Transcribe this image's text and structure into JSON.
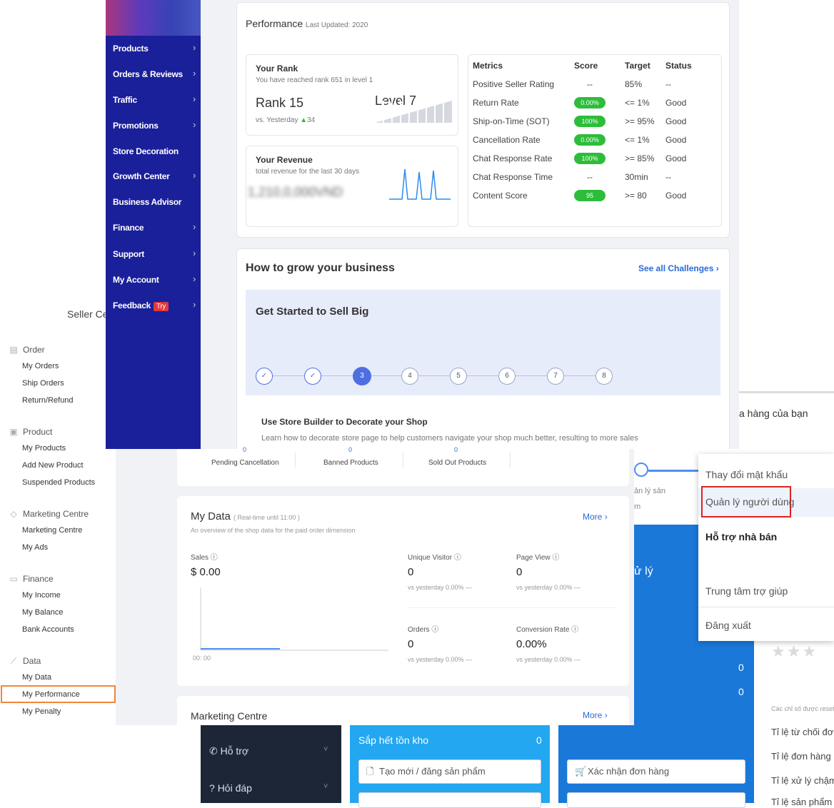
{
  "sidebar": {
    "seller_center_label": "Seller Ce",
    "sections": [
      {
        "title": "Order",
        "icon": "clipboard-icon",
        "items": [
          "My Orders",
          "Ship Orders",
          "Return/Refund"
        ]
      },
      {
        "title": "Product",
        "icon": "box-icon",
        "items": [
          "My Products",
          "Add New Product",
          "Suspended Products"
        ]
      },
      {
        "title": "Marketing Centre",
        "icon": "tag-icon",
        "items": [
          "Marketing Centre",
          "My Ads"
        ]
      },
      {
        "title": "Finance",
        "icon": "wallet-icon",
        "items": [
          "My Income",
          "My Balance",
          "Bank Accounts"
        ]
      },
      {
        "title": "Data",
        "icon": "chart-icon",
        "items": [
          "My Data",
          "My Performance",
          "My Penalty"
        ]
      }
    ],
    "highlight_color": "#f0873a"
  },
  "nav": {
    "items": [
      "Products",
      "Orders & Reviews",
      "Traffic",
      "Promotions",
      "Store Decoration",
      "Growth Center",
      "Business Advisor",
      "Finance",
      "Support",
      "My Account",
      "Feedback"
    ],
    "feedback_badge": "Try",
    "bg_color": "#1a1f9a"
  },
  "performance": {
    "title": "Performance",
    "last_updated": "Last Updated: 2020",
    "rank": {
      "heading": "Your Rank",
      "sub": "You have reached rank 651 in level 1",
      "rank_label": "Rank 15",
      "level_label": "Level 7",
      "vs_label": "vs. Yesterday",
      "delta": "34"
    },
    "revenue": {
      "heading": "Your Revenue",
      "sub": "total revenue for the last 30 days",
      "value_blurred": "1,210,0,000VND"
    },
    "metrics": {
      "headers": [
        "Metrics",
        "Score",
        "Target",
        "Status"
      ],
      "rows": [
        {
          "name": "Positive Seller Rating",
          "score": "--",
          "pill": false,
          "target": "85%",
          "status": "--"
        },
        {
          "name": "Return Rate",
          "score": "0.00%",
          "pill": true,
          "target": "<= 1%",
          "status": "Good"
        },
        {
          "name": "Ship-on-Time (SOT)",
          "score": "100%",
          "pill": true,
          "target": ">= 95%",
          "status": "Good"
        },
        {
          "name": "Cancellation Rate",
          "score": "0.00%",
          "pill": true,
          "target": "<= 1%",
          "status": "Good"
        },
        {
          "name": "Chat Response Rate",
          "score": "100%",
          "pill": true,
          "target": ">= 85%",
          "status": "Good"
        },
        {
          "name": "Chat Response Time",
          "score": "--",
          "pill": false,
          "target": "30min",
          "status": "--"
        },
        {
          "name": "Content Score",
          "score": "95",
          "pill": true,
          "target": ">= 80",
          "status": "Good"
        }
      ],
      "pill_color": "#2dbd3a"
    }
  },
  "grow": {
    "title": "How to grow your business",
    "see_all": "See all Challenges",
    "banner_title": "Get Started to Sell Big",
    "steps": [
      "✓",
      "✓",
      "3",
      "4",
      "5",
      "6",
      "7",
      "8"
    ],
    "task_title": "Use Store Builder to Decorate your Shop",
    "task_desc": "Learn how to decorate store page to help customers navigate your shop much better, resulting to more sales"
  },
  "counters": {
    "items": [
      {
        "value": "0",
        "label": "Pending Cancellation"
      },
      {
        "value": "0",
        "label": "Banned Products"
      },
      {
        "value": "0",
        "label": "Sold Out Products"
      }
    ]
  },
  "my_data": {
    "title": "My Data",
    "realtime": "( Real-time until 11:00 )",
    "desc": "An overview of the shop data for the paid order dimension",
    "more": "More",
    "sales_label": "Sales",
    "sales_value": "$ 0.00",
    "chart_x_label": "00: 00",
    "stats": [
      {
        "label": "Unique Visitor",
        "value": "0",
        "sub": "vs yesterday 0.00% —"
      },
      {
        "label": "Page View",
        "value": "0",
        "sub": "vs yesterday 0.00% —"
      },
      {
        "label": "Orders",
        "value": "0",
        "sub": "vs yesterday 0.00% —"
      },
      {
        "label": "Conversion Rate",
        "value": "0.00%",
        "sub": "vs yesterday 0.00% —"
      }
    ]
  },
  "marketing": {
    "title": "Marketing Centre",
    "more": "More"
  },
  "vn": {
    "top_text": "a hàng của bạn",
    "partial1": "ản lý sản",
    "partial2": "m",
    "partial3": "ử lý",
    "blue_counts": [
      "0",
      "0"
    ],
    "dropdown": {
      "change_password": "Thay đổi mật khẩu",
      "manage_users": "Quản lý người dùng",
      "seller_support": "Hỗ trợ nhà bán",
      "help_center": "Trung tâm trợ giúp",
      "logout": "Đăng xuất"
    },
    "bottom": {
      "support": "Hỗ trợ",
      "faq": "Hỏi đáp",
      "out_of_stock": "Sắp hết tồn kho",
      "out_of_stock_count": "0",
      "create_product": "Tạo mới / đăng sản phẩm",
      "confirm_order": "Xác nhận đơn hàng"
    },
    "right": {
      "reset_note": "Các chỉ số được reset n",
      "rows": [
        "Tỉ lệ từ chối đơn h",
        "Tỉ lệ đơn hàng hủy",
        "Tỉ lệ xử lý chậm",
        "Tỉ lệ sản phẩm lỗi"
      ]
    }
  }
}
